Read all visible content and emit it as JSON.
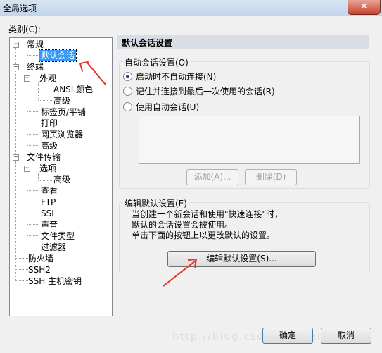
{
  "window": {
    "title": "全局选项",
    "close_glyph": "✕"
  },
  "category_label": "类别(C):",
  "tree": {
    "items": [
      {
        "label": "常规",
        "toggle": "−"
      },
      {
        "label": "默认会话"
      },
      {
        "label": "终端",
        "toggle": "−"
      },
      {
        "label": "外观",
        "toggle": "−"
      },
      {
        "label": "ANSI 颜色"
      },
      {
        "label": "高级"
      },
      {
        "label": "标签页/平铺"
      },
      {
        "label": "打印"
      },
      {
        "label": "网页浏览器"
      },
      {
        "label": "高级"
      },
      {
        "label": "文件传输",
        "toggle": "−"
      },
      {
        "label": "选项",
        "toggle": "−"
      },
      {
        "label": "高级"
      },
      {
        "label": "查看"
      },
      {
        "label": "FTP"
      },
      {
        "label": "SSL"
      },
      {
        "label": "声音"
      },
      {
        "label": "文件类型"
      },
      {
        "label": "过滤器"
      },
      {
        "label": "防火墙"
      },
      {
        "label": "SSH2"
      },
      {
        "label": "SSH 主机密钥"
      }
    ],
    "selected": "默认会话"
  },
  "panel": {
    "title": "默认会话设置",
    "auto_session": {
      "label": "自动会话设置(O)",
      "options": [
        {
          "label": "启动时不自动连接(N)",
          "checked": true
        },
        {
          "label": "记住并连接到最后一次使用的会话(R)",
          "checked": false
        },
        {
          "label": "使用自动会话(U)",
          "checked": false
        }
      ],
      "add_button": "添加(A)...",
      "delete_button": "删除(D)"
    },
    "edit_default": {
      "label": "编辑默认设置(E)",
      "description": [
        "当创建一个新会话和使用\"快速连接\"时，",
        "默认的会话设置会被使用。",
        "单击下面的按钮上以更改默认的设置。"
      ],
      "edit_button": "编辑默认设置(S)..."
    }
  },
  "footer": {
    "ok_button": "确定",
    "cancel_button": "取消"
  },
  "watermark": "http://blog.csdn.net/nemo2008",
  "colors": {
    "selection": "#3399ff",
    "annotation_arrow": "#e3342a",
    "header_bg": "#d9dee6"
  }
}
